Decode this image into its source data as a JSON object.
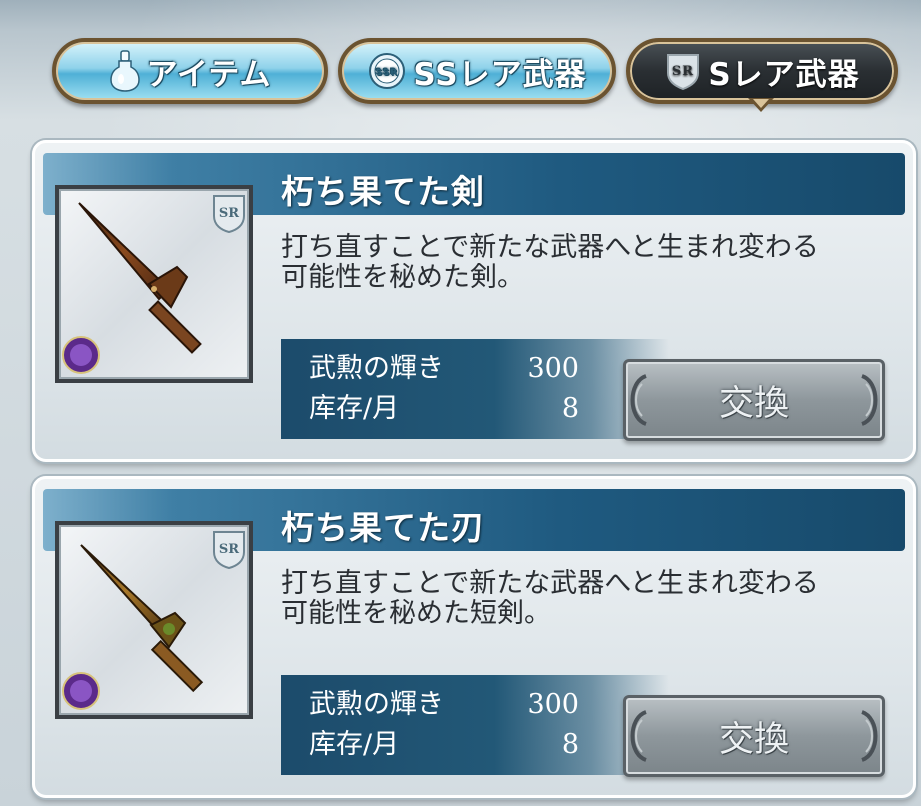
{
  "tabs": [
    {
      "label": "アイテム",
      "icon": "potion-icon",
      "active": false
    },
    {
      "label": "SSレア武器",
      "icon": "ssr-badge-icon",
      "active": false
    },
    {
      "label": "Sレア武器",
      "icon": "sr-badge-icon",
      "active": true
    }
  ],
  "badges": {
    "ssr": "SSR",
    "sr": "SR"
  },
  "items": [
    {
      "name": "朽ち果てた剣",
      "rarity": "SR",
      "element_icon": "dark-element-icon",
      "description_line1": "打ち直すことで新たな武器へと生まれ変わる",
      "description_line2": "可能性を秘めた剣。",
      "cost_label": "武勲の輝き",
      "cost_value": "300",
      "stock_label": "库存/月",
      "stock_value": "8",
      "exchange_label": "交換"
    },
    {
      "name": "朽ち果てた刃",
      "rarity": "SR",
      "element_icon": "dark-element-icon",
      "description_line1": "打ち直すことで新たな武器へと生まれ変わる",
      "description_line2": "可能性を秘めた短剣。",
      "cost_label": "武勲の輝き",
      "cost_value": "300",
      "stock_label": "库存/月",
      "stock_value": "8",
      "exchange_label": "交換"
    }
  ],
  "colors": {
    "header_blue": "#1f5a80",
    "tab_light": "#8fd2ea",
    "tab_dark": "#2a2f33",
    "exchange_gray": "#8e979c"
  }
}
